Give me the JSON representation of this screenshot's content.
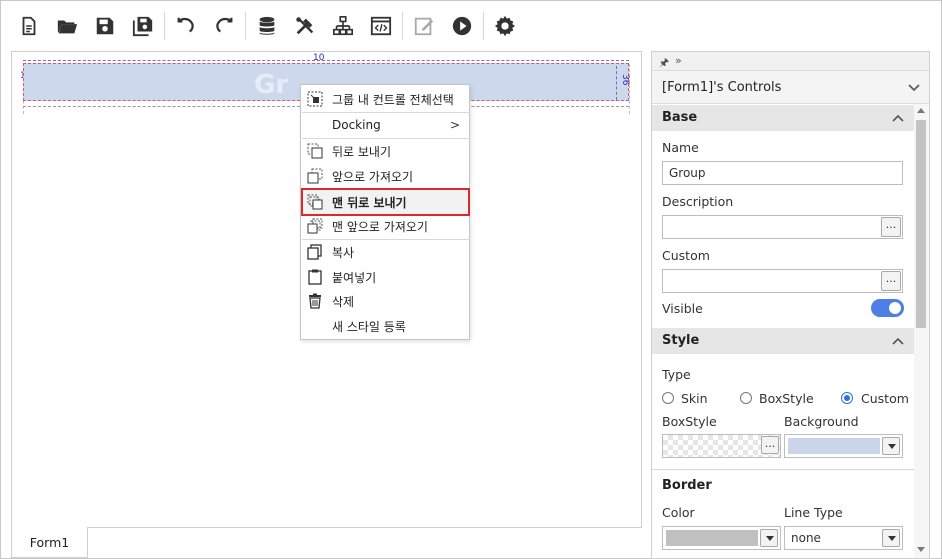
{
  "toolbar": {
    "buttons": [
      "new-file",
      "open-folder",
      "save",
      "save-all",
      "undo",
      "redo",
      "database",
      "tools",
      "hierarchy",
      "code",
      "edit",
      "run",
      "settings"
    ]
  },
  "canvas": {
    "ruler_top": "10",
    "ruler_left": "10",
    "ruler_right": "36",
    "group_ghost_text": "Gr",
    "selected_color": "#ccd9ec"
  },
  "tabs": {
    "form_tab": "Form1"
  },
  "context_menu": {
    "items": [
      {
        "label": "그룹 내 컨트롤 전체선택",
        "icon": "select-all-icon"
      },
      {
        "label": "Docking",
        "icon": "",
        "submenu": ">"
      },
      {
        "label": "뒤로 보내기",
        "icon": "send-backward-icon"
      },
      {
        "label": "앞으로 가져오기",
        "icon": "bring-forward-icon"
      },
      {
        "label": "맨 뒤로 보내기",
        "icon": "send-to-back-icon"
      },
      {
        "label": "맨 앞으로 가져오기",
        "icon": "bring-to-front-icon"
      },
      {
        "label": "복사",
        "icon": "copy-icon"
      },
      {
        "label": "붙여넣기",
        "icon": "paste-icon"
      },
      {
        "label": "삭제",
        "icon": "delete-icon"
      },
      {
        "label": "새 스타일 등록",
        "icon": ""
      }
    ],
    "highlight_color": "#d92b2b"
  },
  "panel": {
    "pin": "🖈",
    "expand": "»",
    "title": "[Form1]'s Controls",
    "base": {
      "header": "Base",
      "name_label": "Name",
      "name_value": "Group",
      "description_label": "Description",
      "description_value": "",
      "custom_label": "Custom",
      "custom_value": "",
      "dots": "...",
      "visible_label": "Visible",
      "visible_on": true
    },
    "style": {
      "header": "Style",
      "type_label": "Type",
      "type_options": [
        "Skin",
        "BoxStyle",
        "Custom"
      ],
      "type_selected": "Custom",
      "boxstyle_label": "BoxStyle",
      "background_label": "Background",
      "background_color": "#c8d5ea"
    },
    "border": {
      "header": "Border",
      "color_label": "Color",
      "color_value": "#c0c0c0",
      "linetype_label": "Line Type",
      "linetype_value": "none"
    }
  },
  "accent": "#4d7fe6"
}
